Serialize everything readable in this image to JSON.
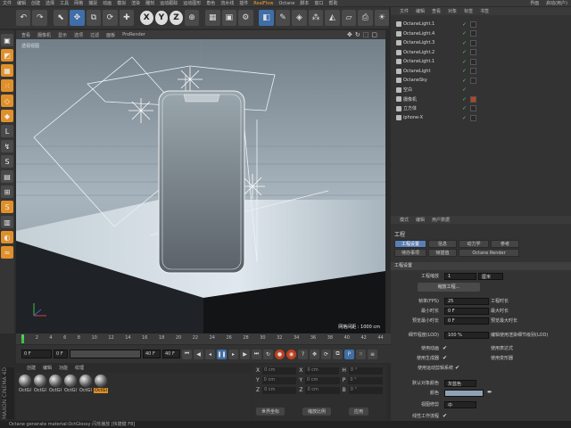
{
  "menubar": {
    "items": [
      "文件",
      "编辑",
      "创建",
      "选择",
      "工具",
      "网格",
      "捕捉",
      "动画",
      "模拟",
      "渲染",
      "雕刻",
      "运动跟踪",
      "运动图形",
      "角色",
      "流水线",
      "插件",
      "RealFlow",
      "Octane",
      "脚本",
      "窗口",
      "帮助"
    ],
    "right": [
      "界面",
      "启动(用户)"
    ]
  },
  "toolbar": {
    "x": "X",
    "y": "Y",
    "z": "Z"
  },
  "viewport": {
    "menu": [
      "查看",
      "摄像机",
      "显示",
      "选项",
      "过滤",
      "面板",
      "ProRender"
    ],
    "persp": "透视视图",
    "grid_label": "网格间距 : 1000 cm"
  },
  "timeline": {
    "ticks": [
      "0",
      "2",
      "4",
      "6",
      "8",
      "10",
      "12",
      "14",
      "16",
      "18",
      "20",
      "22",
      "24",
      "26",
      "28",
      "30",
      "32",
      "34",
      "36",
      "38",
      "40",
      "42",
      "44"
    ],
    "frame_start": "0 F",
    "frame_cur": "0 F",
    "frame_end": "40 F",
    "frame_max": "40 F"
  },
  "materials": {
    "tabs": [
      "创建",
      "编辑",
      "功能",
      "纹理"
    ],
    "items": [
      "OctGl",
      "OctGl",
      "OctGl",
      "OctGl",
      "OctGl",
      "OctGl"
    ],
    "maxon": "MAXON CINEMA 4D"
  },
  "coords": {
    "rows": [
      [
        "X",
        "0 cm",
        "X",
        "0 cm",
        "H",
        "0 °"
      ],
      [
        "Y",
        "0 cm",
        "Y",
        "0 cm",
        "P",
        "0 °"
      ],
      [
        "Z",
        "0 cm",
        "Z",
        "0 cm",
        "B",
        "0 °"
      ]
    ],
    "mode": "世界坐标",
    "size_mode": "缩放比例",
    "apply": "应用"
  },
  "status": "Octane generate material:OctGlossy   闪烁播放 [快捷键 F8]",
  "objects": {
    "tabs": [
      "文件",
      "编辑",
      "查看",
      "对象",
      "标签",
      "书签"
    ],
    "rows": [
      {
        "name": "OctaneLight.1",
        "tag": "dark"
      },
      {
        "name": "OctaneLight.4",
        "tag": "dark"
      },
      {
        "name": "OctaneLight.3",
        "tag": "dark"
      },
      {
        "name": "OctaneLight.2",
        "tag": "dark"
      },
      {
        "name": "OctaneLight.1",
        "tag": "dark"
      },
      {
        "name": "OctaneLight",
        "tag": "dark"
      },
      {
        "name": "OctaneSky",
        "tag": "dark"
      },
      {
        "name": "空白",
        "tag": ""
      },
      {
        "name": "摄像机",
        "tag": "red"
      },
      {
        "name": "立方体",
        "tag": "dark"
      },
      {
        "name": "iphone-X",
        "tag": "dark"
      }
    ]
  },
  "attributes": {
    "tabs": [
      "模式",
      "编辑",
      "用户数据"
    ],
    "title": "工程",
    "subtabs": [
      "工程设置",
      "信息",
      "动力学",
      "参考",
      "待办事项",
      "帧插值",
      "Octane Render"
    ],
    "section": "工程设置",
    "scale_label": "工程缩放",
    "scale_value": "1",
    "scale_unit": "厘米",
    "load_btn": "缩放工程...",
    "fps_label": "帧率(FPS)",
    "fps": "25",
    "project_time_label": "工程时长",
    "min_time_label": "最小时长",
    "min_time": "0 F",
    "max_time_label": "最大时长",
    "preview_min_label": "预览最小时长",
    "preview_min": "0 F",
    "preview_max_label": "预览最大时长",
    "lod_label": "细节程度(LOD)",
    "lod": "100 %",
    "render_lod_label": "编辑使用渲染细节级别(LOD)",
    "use_anim": "使用动画",
    "use_expr": "使用表达式",
    "use_gen": "使用生成器",
    "use_deform": "使用变形器",
    "use_motion": "使用运动剪辑系统",
    "default_color_label": "默认对象颜色",
    "default_color_value": "灰蓝色",
    "color_label": "颜色",
    "view_clip_label": "视图修剪",
    "view_clip_value": "中",
    "linear_flow": "线性工作流程"
  }
}
